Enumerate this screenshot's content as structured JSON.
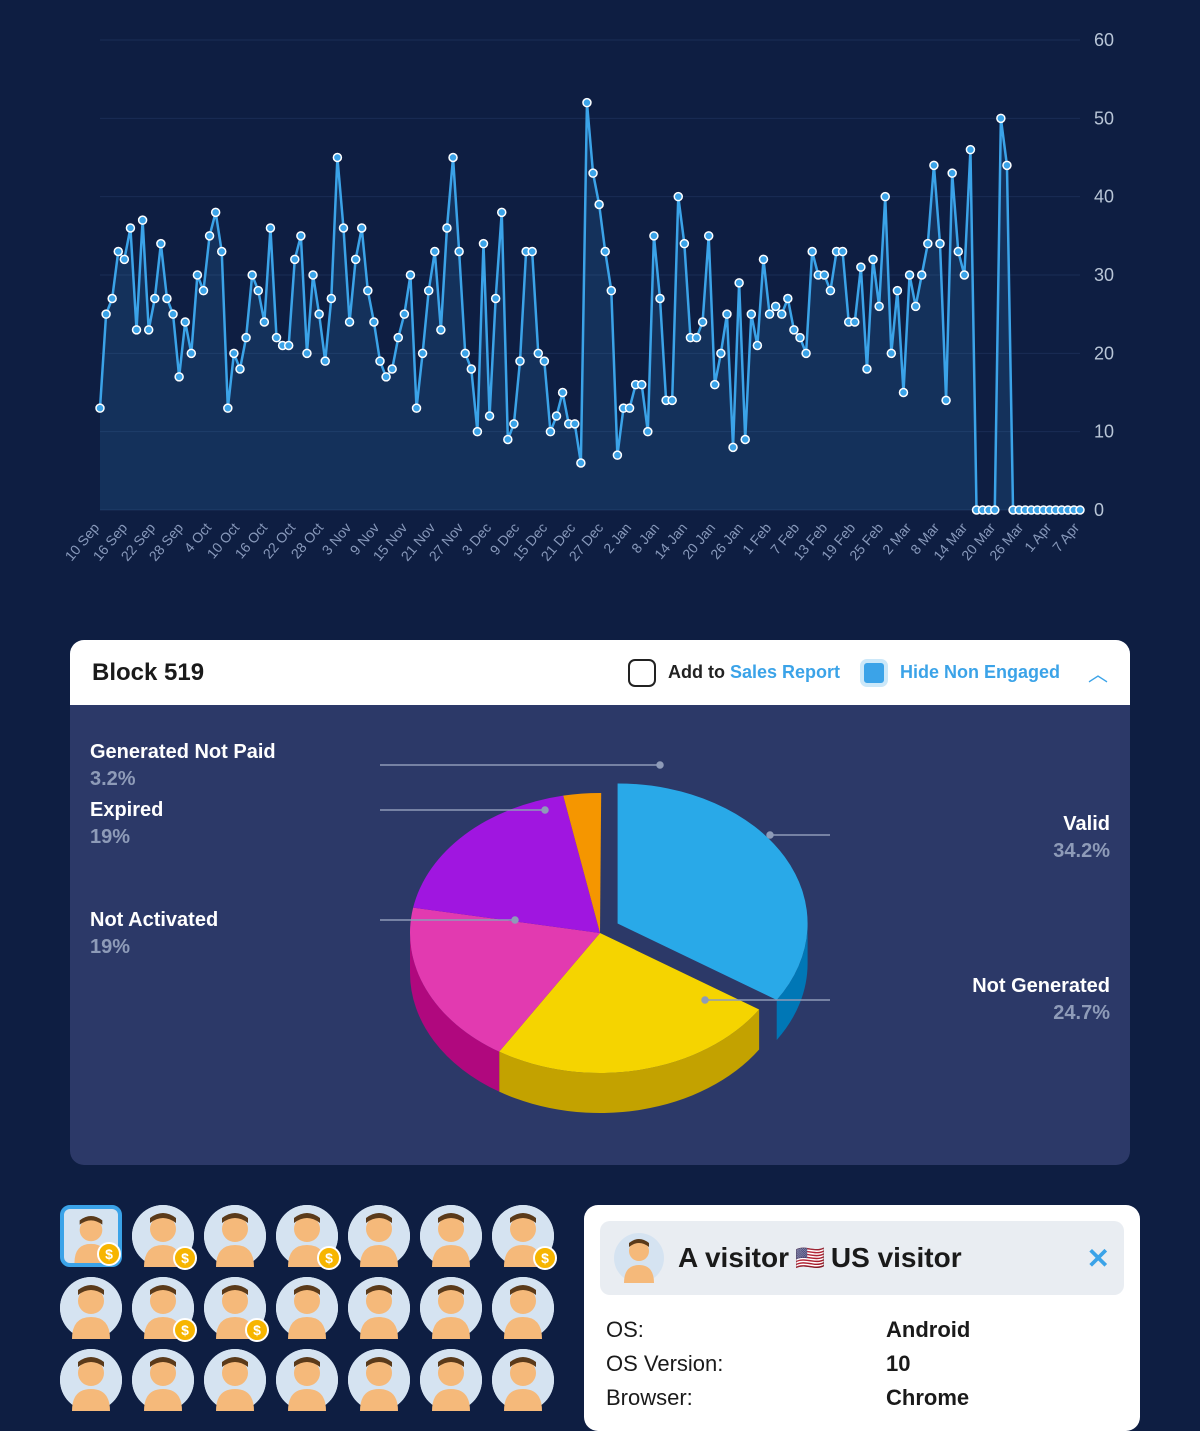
{
  "chart_data": [
    {
      "type": "line",
      "title": "",
      "xlabel": "",
      "ylabel": "",
      "ylim": [
        0,
        60
      ],
      "yticks": [
        0,
        10,
        20,
        30,
        40,
        50,
        60
      ],
      "categories": [
        "10 Sep",
        "16 Sep",
        "22 Sep",
        "28 Sep",
        "4 Oct",
        "10 Oct",
        "16 Oct",
        "22 Oct",
        "28 Oct",
        "3 Nov",
        "9 Nov",
        "15 Nov",
        "21 Nov",
        "27 Nov",
        "3 Dec",
        "9 Dec",
        "15 Dec",
        "21 Dec",
        "27 Dec",
        "2 Jan",
        "8 Jan",
        "14 Jan",
        "20 Jan",
        "26 Jan",
        "1 Feb",
        "7 Feb",
        "13 Feb",
        "19 Feb",
        "25 Feb",
        "2 Mar",
        "8 Mar",
        "14 Mar",
        "20 Mar",
        "26 Mar",
        "1 Apr",
        "7 Apr"
      ],
      "values": [
        13,
        25,
        27,
        33,
        32,
        36,
        23,
        37,
        23,
        27,
        34,
        27,
        25,
        17,
        24,
        20,
        30,
        28,
        35,
        38,
        33,
        13,
        20,
        18,
        22,
        30,
        28,
        24,
        36,
        22,
        21,
        21,
        32,
        35,
        20,
        30,
        25,
        19,
        27,
        45,
        36,
        24,
        32,
        36,
        28,
        24,
        19,
        17,
        18,
        22,
        25,
        30,
        13,
        20,
        28,
        33,
        23,
        36,
        45,
        33,
        20,
        18,
        10,
        34,
        12,
        27,
        38,
        9,
        11,
        19,
        33,
        33,
        20,
        19,
        10,
        12,
        15,
        11,
        11,
        6,
        52,
        43,
        39,
        33,
        28,
        7,
        13,
        13,
        16,
        16,
        10,
        35,
        27,
        14,
        14,
        40,
        34,
        22,
        22,
        24,
        35,
        16,
        20,
        25,
        8,
        29,
        9,
        25,
        21,
        32,
        25,
        26,
        25,
        27,
        23,
        22,
        20,
        33,
        30,
        30,
        28,
        33,
        33,
        24,
        24,
        31,
        18,
        32,
        26,
        40,
        20,
        28,
        15,
        30,
        26,
        30,
        34,
        44,
        34,
        14,
        43,
        33,
        30,
        46,
        0,
        0,
        0,
        0,
        50,
        44,
        0,
        0,
        0,
        0,
        0,
        0,
        0,
        0,
        0,
        0,
        0,
        0
      ]
    },
    {
      "type": "pie",
      "title": "Block 519",
      "series": [
        {
          "name": "Valid",
          "value": 34.2,
          "color": "#29a9e8"
        },
        {
          "name": "Not Generated",
          "value": 24.7,
          "color": "#f5d400"
        },
        {
          "name": "Not Activated",
          "value": 19,
          "color": "#e23ab0"
        },
        {
          "name": "Expired",
          "value": 19,
          "color": "#a016e0"
        },
        {
          "name": "Generated Not Paid",
          "value": 3.2,
          "color": "#f59600"
        }
      ]
    }
  ],
  "block": {
    "title": "Block 519",
    "add_to_prefix": "Add to ",
    "add_to_link": "Sales Report",
    "hide_label": "Hide Non Engaged",
    "labels": {
      "valid": "Valid",
      "valid_pct": "34.2%",
      "not_generated": "Not Generated",
      "not_generated_pct": "24.7%",
      "not_activated": "Not Activated",
      "not_activated_pct": "19%",
      "expired": "Expired",
      "expired_pct": "19%",
      "gen_not_paid": "Generated Not Paid",
      "gen_not_paid_pct": "3.2%"
    }
  },
  "avatars": [
    {
      "selected": true,
      "badge": true
    },
    {
      "selected": false,
      "badge": true
    },
    {
      "selected": false,
      "badge": false
    },
    {
      "selected": false,
      "badge": true
    },
    {
      "selected": false,
      "badge": false
    },
    {
      "selected": false,
      "badge": false
    },
    {
      "selected": false,
      "badge": true
    },
    {
      "selected": false,
      "badge": false
    },
    {
      "selected": false,
      "badge": true
    },
    {
      "selected": false,
      "badge": true
    },
    {
      "selected": false,
      "badge": false
    },
    {
      "selected": false,
      "badge": false
    },
    {
      "selected": false,
      "badge": false
    },
    {
      "selected": false,
      "badge": false
    },
    {
      "selected": false,
      "badge": false
    },
    {
      "selected": false,
      "badge": false
    },
    {
      "selected": false,
      "badge": false
    },
    {
      "selected": false,
      "badge": false
    },
    {
      "selected": false,
      "badge": false
    },
    {
      "selected": false,
      "badge": false
    },
    {
      "selected": false,
      "badge": false
    }
  ],
  "visitor": {
    "title_prefix": "A visitor ",
    "title_suffix": "US visitor",
    "flag": "🇺🇸",
    "details": [
      {
        "k": "OS:",
        "v": "Android"
      },
      {
        "k": "OS Version:",
        "v": "10"
      },
      {
        "k": "Browser:",
        "v": "Chrome"
      }
    ]
  }
}
